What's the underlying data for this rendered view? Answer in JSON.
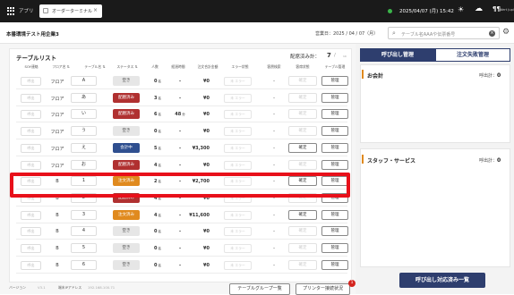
{
  "topbar": {
    "app_label": "アプリ",
    "tab_label": "オーダーターミナル",
    "tab_close": "×",
    "datetime": "2025/04/07 (月) 15:42",
    "weather_icon_1": "☀",
    "weather_icon_2": "☁",
    "tenant_icon": "¶¶",
    "tenant_text": "Wert Jupi"
  },
  "subheader": {
    "company": "本番環境テスト用企業3",
    "business_date": "営業日：2025 / 04 / 07（月）",
    "search_placeholder": "テーブル名AAAや伝票番号",
    "clear_icon": "×",
    "settings_icon": "⚙"
  },
  "table_list": {
    "title": "テーブルリスト",
    "placed_label": "配席済み計：",
    "placed_count": "7",
    "placed_sep": "/",
    "placed_sub": "10",
    "columns": [
      "SOY連絡",
      "フロア名 ⇅",
      "テーブル名 ⇅",
      "ステータス ⇅",
      "人数",
      "経過時間",
      "注文合計金額",
      "エラー状態",
      "客層検索",
      "客席状態",
      "テーブル管理"
    ],
    "rows": [
      {
        "sel": "呼出",
        "floor": "フロア",
        "table": "A",
        "status": "空き",
        "status_kind": "empty",
        "people": "0",
        "elapsed": "-",
        "total": "¥0",
        "error": "未 エラー",
        "seat": "-",
        "check": "確定",
        "check_active": false,
        "manage": "管理"
      },
      {
        "sel": "呼出",
        "floor": "フロア",
        "table": "あ",
        "status": "配膳済み",
        "status_kind": "ordered",
        "people": "3",
        "elapsed": "-",
        "total": "¥0",
        "error": "未 エラー",
        "seat": "-",
        "check": "確定",
        "check_active": false,
        "manage": "管理"
      },
      {
        "sel": "呼出",
        "floor": "フロア",
        "table": "い",
        "status": "配膳済み",
        "status_kind": "ordered",
        "people": "6",
        "elapsed": "48",
        "total": "¥0",
        "error": "未 エラー",
        "seat": "-",
        "check": "確定",
        "check_active": false,
        "manage": "管理"
      },
      {
        "sel": "呼出",
        "floor": "フロア",
        "table": "う",
        "status": "空き",
        "status_kind": "empty",
        "people": "0",
        "elapsed": "-",
        "total": "¥0",
        "error": "未 エラー",
        "seat": "-",
        "check": "確定",
        "check_active": false,
        "manage": "管理"
      },
      {
        "sel": "呼出",
        "floor": "フロア",
        "table": "え",
        "status": "会計中",
        "status_kind": "accounting",
        "people": "5",
        "elapsed": "-",
        "total": "¥3,300",
        "error": "未 エラー",
        "seat": "-",
        "check": "確定",
        "check_active": true,
        "manage": "管理"
      },
      {
        "sel": "呼出",
        "floor": "フロア",
        "table": "お",
        "status": "配膳済み",
        "status_kind": "ordered",
        "people": "4",
        "elapsed": "-",
        "total": "¥0",
        "error": "未 エラー",
        "seat": "-",
        "check": "確定",
        "check_active": false,
        "manage": "管理"
      },
      {
        "sel": "呼出",
        "floor": "B",
        "table": "1",
        "status": "注文済み",
        "status_kind": "served",
        "people": "2",
        "elapsed": "-",
        "total": "¥2,700",
        "error": "未 エラー",
        "seat": "-",
        "check": "確定",
        "check_active": true,
        "manage": "管理"
      },
      {
        "sel": "呼出",
        "floor": "B",
        "table": "2",
        "status": "配膳済み",
        "status_kind": "ordered",
        "people": "4",
        "elapsed": "-",
        "total": "¥0",
        "error": "未 エラー",
        "seat": "-",
        "check": "確定",
        "check_active": false,
        "manage": "管理"
      },
      {
        "sel": "呼出",
        "floor": "B",
        "table": "3",
        "status": "注文済み",
        "status_kind": "served",
        "people": "4",
        "elapsed": "-",
        "total": "¥11,600",
        "error": "未 エラー",
        "seat": "-",
        "check": "確定",
        "check_active": true,
        "manage": "管理"
      },
      {
        "sel": "呼出",
        "floor": "B",
        "table": "4",
        "status": "空き",
        "status_kind": "empty",
        "people": "0",
        "elapsed": "-",
        "total": "¥0",
        "error": "未 エラー",
        "seat": "-",
        "check": "確定",
        "check_active": false,
        "manage": "管理"
      },
      {
        "sel": "呼出",
        "floor": "B",
        "table": "5",
        "status": "空き",
        "status_kind": "empty",
        "people": "0",
        "elapsed": "-",
        "total": "¥0",
        "error": "未 エラー",
        "seat": "-",
        "check": "確定",
        "check_active": false,
        "manage": "管理"
      },
      {
        "sel": "呼出",
        "floor": "B",
        "table": "6",
        "status": "空き",
        "status_kind": "empty",
        "people": "0",
        "elapsed": "-",
        "total": "¥0",
        "error": "未 エラー",
        "seat": "-",
        "check": "確定",
        "check_active": false,
        "manage": "管理"
      }
    ],
    "people_unit": "名",
    "elapsed_unit": "分"
  },
  "footer": {
    "version_label": "バージョン",
    "version": "V3.1",
    "ip_label": "端末IPアドレス",
    "ip": "192.168.100.71",
    "group_button": "テーブルグループ一覧",
    "printer_button": "プリンター接続状況",
    "printer_badge": "1"
  },
  "right": {
    "tab_call": "呼び出し管理",
    "tab_error": "注文失敗管理",
    "sections": [
      {
        "title": "お会計",
        "count_label": "呼出計：",
        "count": "0",
        "color": "#e08a1e"
      },
      {
        "title": "スタッフ・サービス",
        "count_label": "呼出計：",
        "count": "0",
        "color": "#e08a1e"
      }
    ],
    "done_button": "呼び出し対応済み一覧"
  }
}
